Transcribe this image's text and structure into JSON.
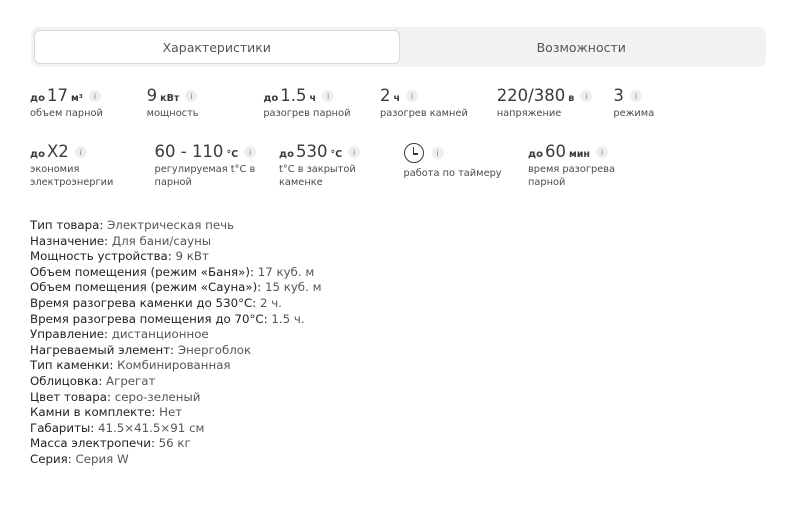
{
  "tabs": [
    {
      "label": "Характеристики",
      "active": true
    },
    {
      "label": "Возможности",
      "active": false
    }
  ],
  "features": [
    [
      {
        "prefix": "до",
        "value": "17",
        "unit": "м³",
        "label": "объем парной"
      },
      {
        "prefix": "",
        "value": "9",
        "unit": "кВт",
        "label": "мощность"
      },
      {
        "prefix": "до",
        "value": "1.5",
        "unit": "ч",
        "label": "разогрев парной"
      },
      {
        "prefix": "",
        "value": "2",
        "unit": "ч",
        "label": "разогрев камней"
      },
      {
        "prefix": "",
        "value": "220/380",
        "unit": "в",
        "label": "напряжение"
      },
      {
        "prefix": "",
        "value": "3",
        "unit": "",
        "label": "режима"
      }
    ],
    [
      {
        "prefix": "до",
        "value": "X2",
        "unit": "",
        "label": "экономия электроэнергии"
      },
      {
        "prefix": "",
        "value": "60 - 110",
        "unit": "°C",
        "label": "регулируемая t°C в парной"
      },
      {
        "prefix": "до",
        "value": "530",
        "unit": "°C",
        "label": "t°C в закрытой каменке"
      },
      {
        "icon": "clock-icon",
        "label": "работа по таймеру"
      },
      {
        "prefix": "до",
        "value": "60",
        "unit": "мин",
        "label": "время разогрева парной"
      }
    ]
  ],
  "info_glyph": "i",
  "specs": [
    {
      "key": "Тип товара:",
      "value": "Электрическая печь"
    },
    {
      "key": "Назначение:",
      "value": "Для бани/сауны"
    },
    {
      "key": "Мощность устройства:",
      "value": "9 кВт"
    },
    {
      "key": "Объем помещения (режим «Баня»):",
      "value": "17 куб. м"
    },
    {
      "key": "Объем помещения (режим «Сауна»):",
      "value": "15 куб. м"
    },
    {
      "key": "Время разогрева каменки до 530°C:",
      "value": "2 ч."
    },
    {
      "key": "Время разогрева помещения до 70°C:",
      "value": "1.5 ч."
    },
    {
      "key": "Управление:",
      "value": "дистанционное"
    },
    {
      "key": "Нагреваемый элемент:",
      "value": "Энергоблок"
    },
    {
      "key": "Тип каменки:",
      "value": "Комбинированная"
    },
    {
      "key": "Облицовка:",
      "value": "Агрегат"
    },
    {
      "key": "Цвет товара:",
      "value": "серо-зеленый"
    },
    {
      "key": "Камни в комплекте:",
      "value": "Нет"
    },
    {
      "key": "Габариты:",
      "value": "41.5×41.5×91 см"
    },
    {
      "key": "Масса электропечи:",
      "value": "56 кг"
    },
    {
      "key": "Серия:",
      "value": "Серия W"
    }
  ]
}
